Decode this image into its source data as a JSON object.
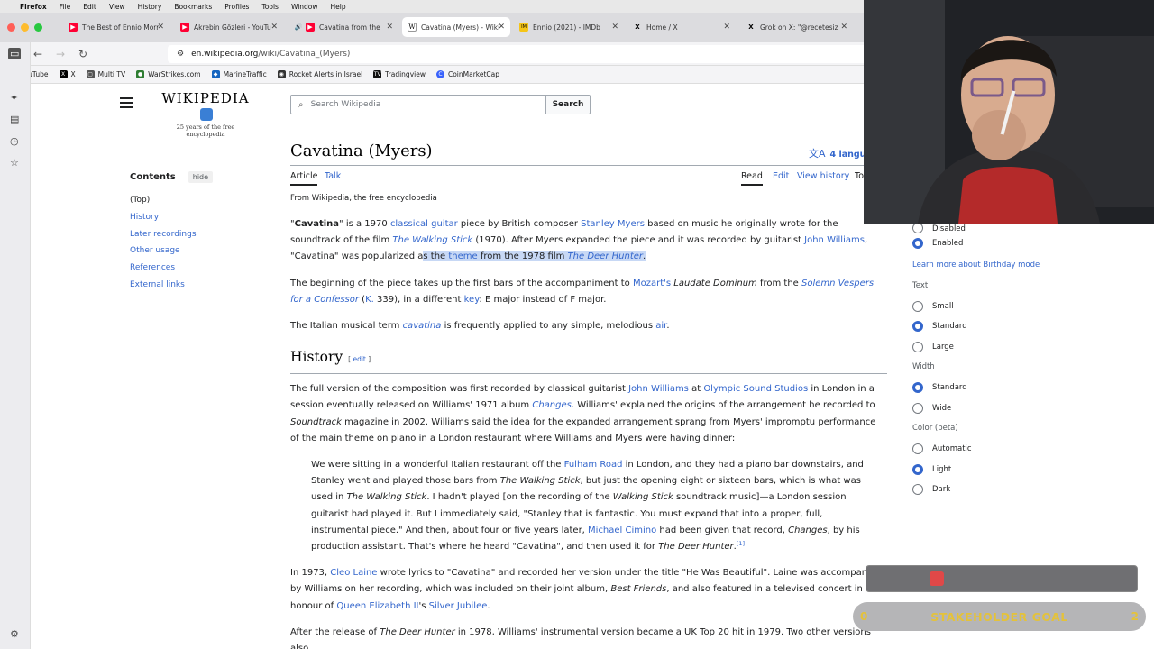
{
  "mac_menu": {
    "apple": "",
    "app": "Firefox",
    "items": [
      "File",
      "Edit",
      "View",
      "History",
      "Bookmarks",
      "Profiles",
      "Tools",
      "Window",
      "Help"
    ]
  },
  "tabs": [
    {
      "label": "The Best of Ennio Morr",
      "icon": "youtube-icon",
      "color": "#ff0033",
      "active": false
    },
    {
      "label": "Akrebin Gözleri - YouTu",
      "icon": "youtube-icon",
      "color": "#ff0033",
      "active": false
    },
    {
      "label": "Cavatina from the",
      "icon": "speaker-icon",
      "color": "#444444",
      "active": false
    },
    {
      "label": "Cavatina (Myers) - Wiki",
      "icon": "wikipedia-icon",
      "color": "#666666",
      "active": true
    },
    {
      "label": "Ennio (2021) - IMDb",
      "icon": "imdb-icon",
      "color": "#f5c518",
      "active": false
    },
    {
      "label": "Home / X",
      "icon": "x-icon",
      "color": "#000000",
      "active": false
    },
    {
      "label": "Grok on X: \"@recetesiz",
      "icon": "x-icon",
      "color": "#000000",
      "active": false
    }
  ],
  "urlbar": {
    "host": "en.wikipedia.org",
    "path": "/wiki/Cavatina_(Myers)"
  },
  "bookmarks": [
    {
      "label": "YouTube",
      "color": "#ff0033"
    },
    {
      "label": "X",
      "color": "#000000"
    },
    {
      "label": "Multi TV",
      "color": "#555555"
    },
    {
      "label": "WarStrikes.com",
      "color": "#2e7d32"
    },
    {
      "label": "MarineTraffic",
      "color": "#1565c0"
    },
    {
      "label": "Rocket Alerts in Israel",
      "color": "#333333"
    },
    {
      "label": "Tradingview",
      "color": "#111111"
    },
    {
      "label": "CoinMarketCap",
      "color": "#3861fb"
    }
  ],
  "wiki": {
    "wordmark": "WIKIPEDIA",
    "tagline": "25 years of the free encyclopedia",
    "search_placeholder": "Search Wikipedia",
    "search_button": "Search"
  },
  "toc": {
    "heading": "Contents",
    "hide": "hide",
    "items": [
      "(Top)",
      "History",
      "Later recordings",
      "Other usage",
      "References",
      "External links"
    ]
  },
  "article": {
    "title": "Cavatina (Myers)",
    "languages": "4 languag",
    "tab_article": "Article",
    "tab_talk": "Talk",
    "tab_read": "Read",
    "tab_edit": "Edit",
    "tab_history": "View history",
    "tab_tools": "To",
    "from": "From Wikipedia, the free encyclopedia",
    "history_heading": "History",
    "edit_link": "edit"
  },
  "appearance": {
    "disabled_label": "Disabled",
    "enabled_label": "Enabled",
    "birthday_link": "Learn more about Birthday mode",
    "text_heading": "Text",
    "text_options": [
      "Small",
      "Standard",
      "Large"
    ],
    "text_selected": "Standard",
    "width_heading": "Width",
    "width_options": [
      "Standard",
      "Wide"
    ],
    "width_selected": "Standard",
    "color_heading": "Color (beta)",
    "color_options": [
      "Automatic",
      "Light",
      "Dark"
    ],
    "color_selected": "Light"
  },
  "stream_overlay": {
    "goal_label": "STAKEHOLDER GOAL",
    "goal_start": "0",
    "goal_end": "2"
  },
  "colors": {
    "link": "#3366cc",
    "selection": "#c7d8f5",
    "goal_text": "#e4c23a"
  }
}
